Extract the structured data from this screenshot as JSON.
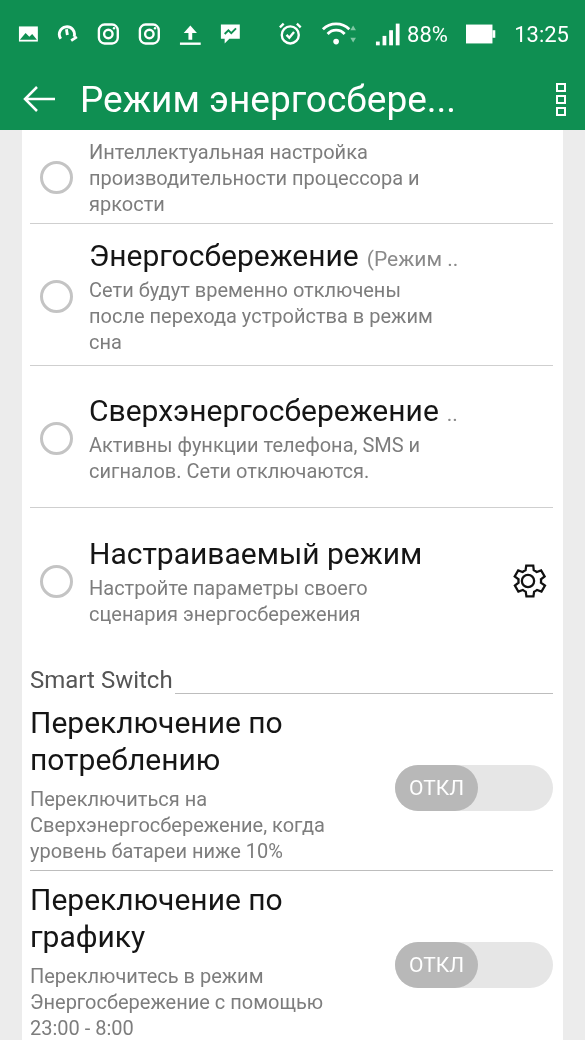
{
  "status_bar": {
    "battery": "88%",
    "time": "13:25"
  },
  "app_bar": {
    "title": "Режим энергосбере..."
  },
  "modes": [
    {
      "description": "Интеллектуальная настройка производительности процессора и яркости",
      "selected": false,
      "settings": false
    },
    {
      "title": "Энергосбережение",
      "suffix": "(Режим ..",
      "description": "Сети будут временно отключены после перехода устройства в режим сна",
      "selected": false,
      "settings": false
    },
    {
      "title": "Сверхэнергосбережение",
      "suffix": "..",
      "description": "Активны функции телефона, SMS и сигналов. Сети отключаются.",
      "selected": false,
      "settings": false
    },
    {
      "title": "Настраиваемый режим",
      "description": "Настройте параметры своего сценария энергосбережения",
      "selected": false,
      "settings": true
    }
  ],
  "section_header": "Smart Switch",
  "switches": [
    {
      "title": "Переключение по потреблению",
      "description": "Переключиться на Сверхэнергосбережение, когда уровень батареи ниже 10%",
      "on": false,
      "state_label": "ОТКЛ"
    },
    {
      "title": "Переключение по графику",
      "description": "Переключитесь в режим Энергосбережение с помощью 23:00 - 8:00",
      "on": false,
      "state_label": "ОТКЛ"
    }
  ]
}
